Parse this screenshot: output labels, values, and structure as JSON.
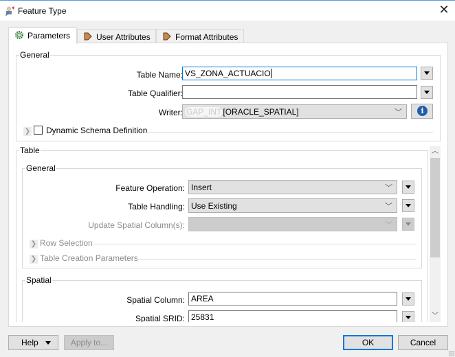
{
  "window": {
    "title": "Feature Type",
    "icon": "fme-workbench-icon",
    "close_icon": "close-icon"
  },
  "tabs": [
    {
      "label": "Parameters",
      "icon": "gear-icon",
      "active": true
    },
    {
      "label": "User Attributes",
      "icon": "arrow-right-icon",
      "active": false
    },
    {
      "label": "Format Attributes",
      "icon": "arrow-right-icon",
      "active": false
    }
  ],
  "general": {
    "legend": "General",
    "table_name": {
      "label": "Table Name:",
      "value": "VS_ZONA_ACTUACIO"
    },
    "table_qualifier": {
      "label": "Table Qualifier:",
      "value": ""
    },
    "writer": {
      "label": "Writer:",
      "prefix": "GAP_INT",
      "value": "[ORACLE_SPATIAL]"
    },
    "dynamic_schema": {
      "label": "Dynamic Schema Definition",
      "checked": false
    }
  },
  "table": {
    "legend": "Table",
    "general": {
      "legend": "General",
      "feature_operation": {
        "label": "Feature Operation:",
        "value": "Insert"
      },
      "table_handling": {
        "label": "Table Handling:",
        "value": "Use Existing"
      },
      "update_spatial_columns": {
        "label": "Update Spatial Column(s):",
        "value": "",
        "disabled": true
      },
      "row_selection": "Row Selection",
      "table_creation_parameters": "Table Creation Parameters"
    },
    "spatial": {
      "legend": "Spatial",
      "spatial_column": {
        "label": "Spatial Column:",
        "value": "AREA"
      },
      "spatial_srid": {
        "label": "Spatial SRID:",
        "value": "25831"
      }
    }
  },
  "footer": {
    "help": "Help",
    "apply_to": "Apply to...",
    "ok": "OK",
    "cancel": "Cancel"
  }
}
